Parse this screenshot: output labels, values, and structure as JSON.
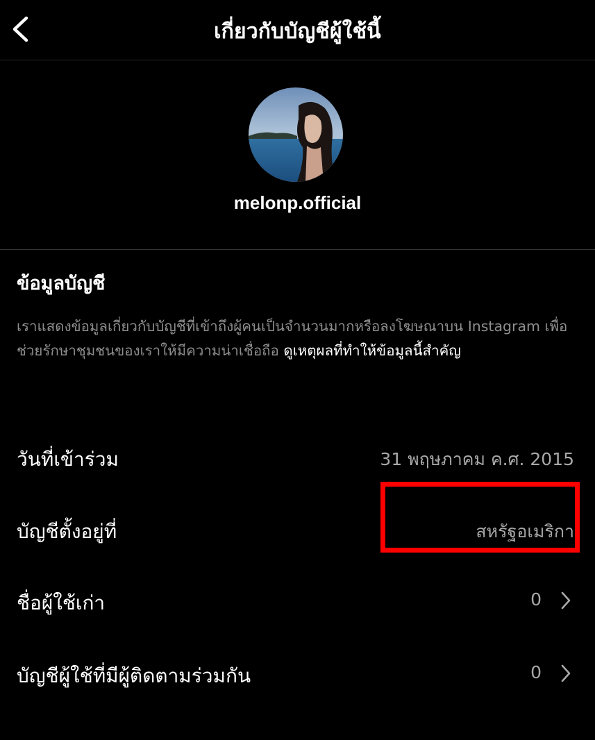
{
  "header": {
    "title": "เกี่ยวกับบัญชีผู้ใช้นี้",
    "back_icon": "chevron-left-icon"
  },
  "profile": {
    "username": "melonp.official",
    "avatar": "profile-photo"
  },
  "account_info": {
    "title": "ข้อมูลบัญชี",
    "description": "เราแสดงข้อมูลเกี่ยวกับบัญชีที่เข้าถึงผู้คนเป็นจำนวนมากหรือลงโฆษณาบน Instagram เพื่อช่วยรักษาชุมชนของเราให้มีความน่าเชื่อถือ",
    "link_text": "ดูเหตุผลที่ทำให้ข้อมูลนี้สำคัญ"
  },
  "rows": [
    {
      "label": "วันที่เข้าร่วม",
      "value": "31 พฤษภาคม ค.ศ. 2015"
    },
    {
      "label": "บัญชีตั้งอยู่ที่",
      "value": "สหรัฐอเมริกา"
    },
    {
      "label": "ชื่อผู้ใช้เก่า",
      "value": "0",
      "icon": "chevron-right-icon"
    },
    {
      "label": "บัญชีผู้ใช้ที่มีผู้ติดตามร่วมกัน",
      "value": "0",
      "icon": "chevron-right-icon"
    }
  ],
  "colors": {
    "background": "#000000",
    "text": "#ffffff",
    "secondary_text": "#8e8e8e",
    "highlight": "#ff0000"
  }
}
